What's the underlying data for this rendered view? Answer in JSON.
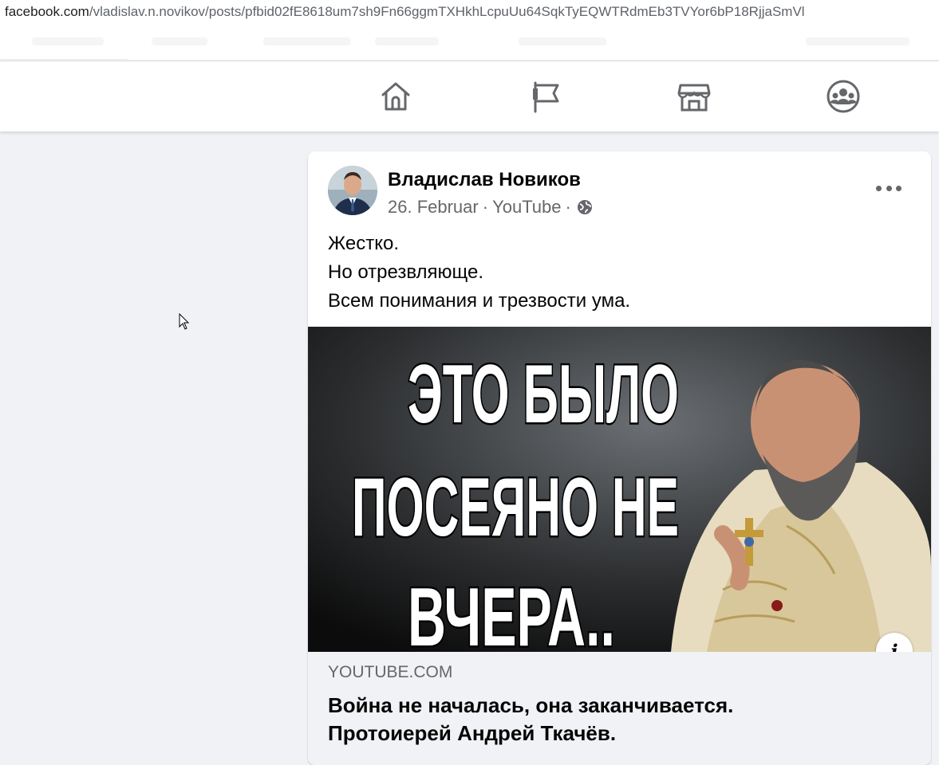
{
  "browser": {
    "url_host": "facebook.com",
    "url_path": "/vladislav.n.novikov/posts/pfbid02fE8618um7sh9Fn66ggmTXHkhLcpuUu64SqkTyEQWTRdmEb3TVYor6bP18RjjaSmVl"
  },
  "nav": {
    "icons": [
      "home-icon",
      "flag-pages-icon",
      "marketplace-icon",
      "groups-icon"
    ]
  },
  "post": {
    "author": "Владислав Новиков",
    "date": "26. Februar",
    "separator": "·",
    "source": "YouTube",
    "audience_icon": "globe-icon",
    "text_lines": [
      "Жестко.",
      "Но отрезвляюще.",
      "Всем понимания и трезвости ума."
    ],
    "thumbnail_lines": [
      "ЭТО БЫЛО",
      "ПОСЕЯНО НЕ",
      "ВЧЕРА.."
    ],
    "info_label": "i",
    "link": {
      "domain": "YOUTUBE.COM",
      "title_lines": [
        "Война не началась, она заканчивается.",
        "Протоиерей Андрей Ткачёв."
      ]
    }
  },
  "colors": {
    "background": "#f0f2f5",
    "card": "#ffffff",
    "primary_text": "#050505",
    "secondary_text": "#65676b",
    "icon": "#65676b"
  }
}
